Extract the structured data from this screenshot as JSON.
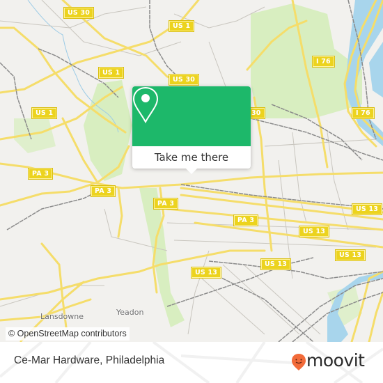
{
  "map": {
    "attribution": "© OpenStreetMap contributors",
    "colors": {
      "land": "#f2f1ee",
      "park": "#d8eec0",
      "water": "#a8d5ec",
      "highway": "#f5dd6a",
      "road_minor": "#c9c6bf",
      "rail": "#8a8a8a",
      "shield": "#ecd31e"
    },
    "shields": [
      {
        "label": "US 30"
      },
      {
        "label": "US 1"
      },
      {
        "label": "US 1"
      },
      {
        "label": "US 1"
      },
      {
        "label": "US 30"
      },
      {
        "label": "30"
      },
      {
        "label": "I 76"
      },
      {
        "label": "I 76"
      },
      {
        "label": "PA 3"
      },
      {
        "label": "PA 3"
      },
      {
        "label": "PA 3"
      },
      {
        "label": "PA 3"
      },
      {
        "label": "US 13"
      },
      {
        "label": "US 13"
      },
      {
        "label": "US 13"
      },
      {
        "label": "US 13"
      },
      {
        "label": "US 13"
      }
    ],
    "places": [
      {
        "label": "Lansdowne"
      },
      {
        "label": "Yeadon"
      }
    ]
  },
  "popup": {
    "icon": "location-pin-icon",
    "button_label": "Take me there",
    "color": "#1db86a"
  },
  "footer": {
    "place_name": "Ce-Mar Hardware, Philadelphia",
    "brand": "moovit",
    "brand_color": "#f26b3a"
  }
}
